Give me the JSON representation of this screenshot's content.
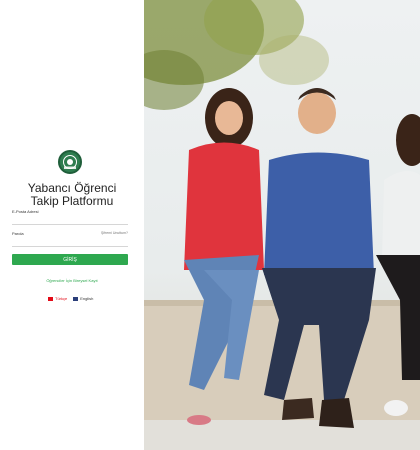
{
  "login": {
    "title_line1": "Yabancı Öğrenci",
    "title_line2": "Takip Platformu",
    "email_label": "E-Posta Adresi",
    "password_label": "Parola",
    "forgot_password": "Şifremi Unuttum?",
    "login_button": "GİRİŞ",
    "register_link": "Öğrenciler İçin Bireysel Kayıt"
  },
  "languages": [
    {
      "label": "Türkçe",
      "flag_color": "#e30a17"
    },
    {
      "label": "English",
      "flag_color": "#2b3f7a"
    }
  ],
  "colors": {
    "accent": "#2ea84f",
    "logo": "#2e7d4f"
  },
  "icons": {
    "logo": "university-emblem-icon"
  }
}
